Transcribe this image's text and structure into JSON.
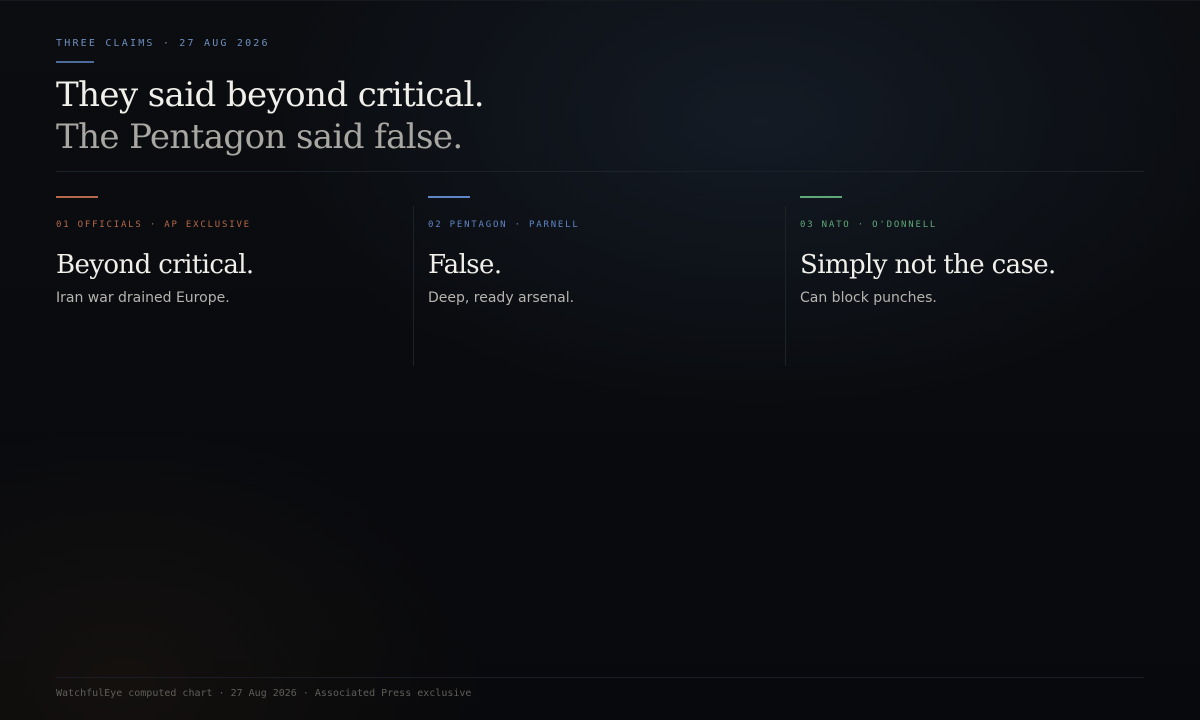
{
  "header": {
    "eyebrow": "THREE CLAIMS · 27 AUG 2026",
    "headline_line1": "They said beyond critical.",
    "headline_line2": "The Pentagon said false."
  },
  "claims": [
    {
      "label": "01 OFFICIALS · AP EXCLUSIVE",
      "title": "Beyond critical.",
      "subtitle": "Iran war drained Europe.",
      "accent_color": "#b5694a"
    },
    {
      "label": "02 PENTAGON · PARNELL",
      "title": "False.",
      "subtitle": "Deep, ready arsenal.",
      "accent_color": "#5f86c4"
    },
    {
      "label": "03 NATO · O'DONNELL",
      "title": "Simply not the case.",
      "subtitle": "Can block punches.",
      "accent_color": "#5fa878"
    }
  ],
  "footer": {
    "text": "WatchfulEye computed chart · 27 Aug 2026 · Associated Press exclusive"
  },
  "colors": {
    "background": "#0a0c10",
    "eyebrow": "#6f8fbf"
  }
}
